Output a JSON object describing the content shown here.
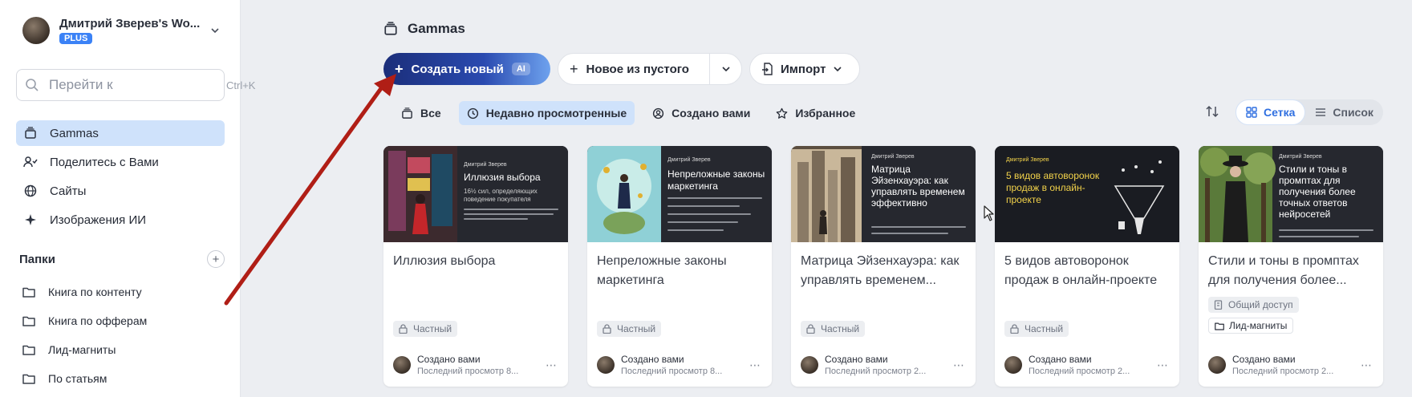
{
  "workspace": {
    "name": "Дмитрий Зверев's Wo...",
    "plan": "PLUS"
  },
  "search": {
    "placeholder": "Перейти к",
    "shortcut": "Ctrl+K"
  },
  "nav": [
    {
      "label": "Gammas",
      "icon": "stack-icon",
      "active": true
    },
    {
      "label": "Поделитесь с Вами",
      "icon": "users-icon"
    },
    {
      "label": "Сайты",
      "icon": "globe-icon"
    },
    {
      "label": "Изображения ИИ",
      "icon": "sparkle-icon"
    }
  ],
  "folders": {
    "title": "Папки",
    "items": [
      "Книга по контенту",
      "Книга по офферам",
      "Лид-магниты",
      "По статьям"
    ]
  },
  "main": {
    "title": "Gammas",
    "create_label": "Создать новый",
    "ai_badge": "AI",
    "blank_label": "Новое из пустого",
    "import_label": "Импорт"
  },
  "filters": [
    {
      "label": "Все",
      "icon": "stack-icon"
    },
    {
      "label": "Недавно просмотренные",
      "icon": "clock-icon",
      "active": true
    },
    {
      "label": "Создано вами",
      "icon": "user-circle-icon"
    },
    {
      "label": "Избранное",
      "icon": "star-icon"
    }
  ],
  "view": {
    "grid_label": "Сетка",
    "list_label": "Список"
  },
  "cards": [
    {
      "title": "Иллюзия выбора",
      "thumb": {
        "author": "Дмитрий Зверев",
        "title": "Иллюзия выбора",
        "subtitle": "16½ сил, определяющих поведение покупателя"
      },
      "badges": [
        {
          "label": "Частный",
          "icon": "lock-icon"
        }
      ],
      "creator": "Создано вами",
      "viewed": "Последний просмотр 8..."
    },
    {
      "title": "Непреложные законы маркетинга",
      "thumb": {
        "author": "Дмитрий Зверев",
        "title": "Непреложные законы маркетинга",
        "subtitle": ""
      },
      "badges": [
        {
          "label": "Частный",
          "icon": "lock-icon"
        }
      ],
      "creator": "Создано вами",
      "viewed": "Последний просмотр 8..."
    },
    {
      "title": "Матрица Эйзенхауэра: как управлять временем...",
      "thumb": {
        "author": "Дмитрий Зверев",
        "title": "Матрица Эйзенхауэра: как управлять временем эффективно",
        "subtitle": ""
      },
      "badges": [
        {
          "label": "Частный",
          "icon": "lock-icon"
        }
      ],
      "creator": "Создано вами",
      "viewed": "Последний просмотр 2..."
    },
    {
      "title": "5 видов автоворонок продаж в онлайн-проекте",
      "thumb": {
        "author": "Дмитрий Зверев",
        "title": "5 видов автоворонок продаж в онлайн-проекте",
        "subtitle": ""
      },
      "badges": [
        {
          "label": "Частный",
          "icon": "lock-icon"
        }
      ],
      "creator": "Создано вами",
      "viewed": "Последний просмотр 2..."
    },
    {
      "title": "Стили и тоны в промптах для получения более...",
      "thumb": {
        "author": "Дмитрий Зверев",
        "title": "Стили и тоны в промптах для получения более точных ответов нейросетей",
        "subtitle": ""
      },
      "badges": [
        {
          "label": "Общий доступ",
          "icon": "building-icon"
        },
        {
          "label": "Лид-магниты",
          "icon": "folder-icon"
        }
      ],
      "creator": "Создано вами",
      "viewed": "Последний просмотр 2..."
    }
  ],
  "colors": {
    "accent": "#2f6fe0",
    "active_bg": "#cfe2fb",
    "annotation_arrow": "#b01e16"
  }
}
